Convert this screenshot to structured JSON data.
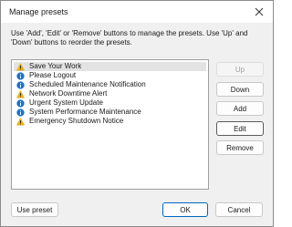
{
  "window": {
    "title": "Manage presets"
  },
  "description": "Use 'Add', 'Edit' or 'Remove' buttons to manage the presets. Use 'Up' and 'Down' buttons to reorder the presets.",
  "presets": [
    {
      "label": "Save Your Work",
      "icon": "warning-icon",
      "selected": true
    },
    {
      "label": "Please Logout",
      "icon": "info-icon",
      "selected": false
    },
    {
      "label": "Scheduled Maintenance Notification",
      "icon": "info-icon",
      "selected": false
    },
    {
      "label": "Network Downtime Alert",
      "icon": "warning-icon",
      "selected": false
    },
    {
      "label": "Urgent System Update",
      "icon": "info-icon",
      "selected": false
    },
    {
      "label": "System Performance Maintenance",
      "icon": "info-icon",
      "selected": false
    },
    {
      "label": "Emergency Shutdown Notice",
      "icon": "warning-icon",
      "selected": false
    }
  ],
  "buttons": {
    "up": "Up",
    "down": "Down",
    "add": "Add",
    "edit": "Edit",
    "remove": "Remove",
    "use_preset": "Use preset",
    "ok": "OK",
    "cancel": "Cancel"
  },
  "colors": {
    "warning": "#f2b400",
    "info": "#1a73c9",
    "accent": "#0067c0"
  }
}
